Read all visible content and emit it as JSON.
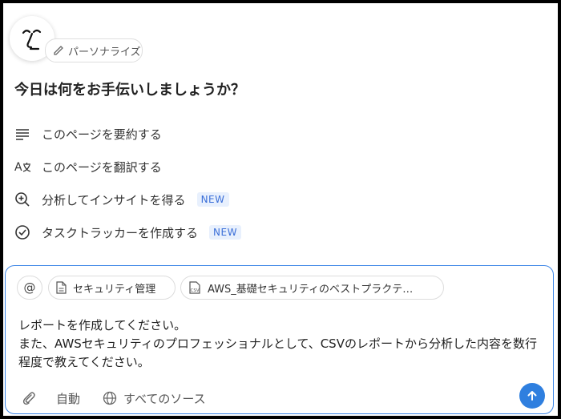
{
  "header": {
    "personalize_label": "パーソナライズ"
  },
  "greeting": "今日は何をお手伝いしましょうか？",
  "actions": [
    {
      "label": "このページを要約する",
      "icon": "list-lines-icon",
      "badge": ""
    },
    {
      "label": "このページを翻訳する",
      "icon": "translate-icon",
      "badge": ""
    },
    {
      "label": "分析してインサイトを得る",
      "icon": "zoom-in-icon",
      "badge": "NEW"
    },
    {
      "label": "タスクトラッカーを作成する",
      "icon": "check-circle-icon",
      "badge": "NEW"
    }
  ],
  "composer": {
    "mention_symbol": "@",
    "context_chips": [
      {
        "label": "セキュリティ管理",
        "icon": "document-icon"
      },
      {
        "label": "AWS_基礎セキュリティのベストプラクテ…",
        "icon": "csv-file-icon"
      }
    ],
    "message": "レポートを作成してください。\nまた、AWSセキュリティのプロフェッショナルとして、CSVのレポートから分析した内容を数行程度で教えてください。",
    "mode_label": "自動",
    "source_label": "すべてのソース"
  },
  "colors": {
    "accent": "#2f7fdf",
    "badge_bg": "#e8f0fd",
    "badge_text": "#3b6fd8"
  }
}
